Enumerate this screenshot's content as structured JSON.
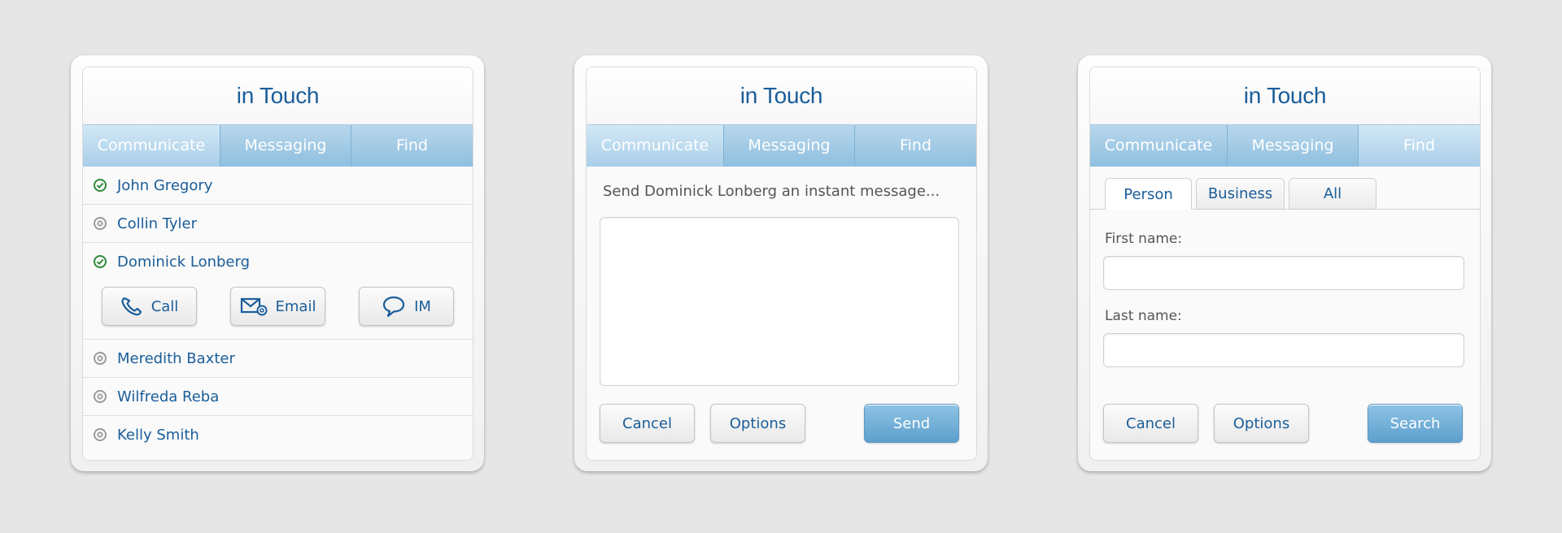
{
  "app": {
    "title": "in Touch"
  },
  "tabs": [
    "Communicate",
    "Messaging",
    "Find"
  ],
  "colors": {
    "brand": "#1a5d99",
    "tab_bar": "#8fbfdf",
    "online": "#2e8b3a",
    "offline": "#9a9a9a",
    "primary_button": "#5d9fcd"
  },
  "contacts": [
    {
      "name": "John Gregory",
      "status": "online"
    },
    {
      "name": "Collin Tyler",
      "status": "offline"
    },
    {
      "name": "Dominick Lonberg",
      "status": "online"
    },
    {
      "name": "Meredith Baxter",
      "status": "offline"
    },
    {
      "name": "Wilfreda Reba",
      "status": "offline"
    },
    {
      "name": "Kelly Smith",
      "status": "offline"
    }
  ],
  "contact_actions": {
    "call": {
      "label": "Call",
      "icon": "phone-icon"
    },
    "email": {
      "label": "Email",
      "icon": "email-icon"
    },
    "im": {
      "label": "IM",
      "icon": "chat-bubble-icon"
    }
  },
  "messaging": {
    "prompt": "Send Dominick Lonberg an instant message...",
    "message_value": "",
    "cancel": "Cancel",
    "options": "Options",
    "send": "Send"
  },
  "find": {
    "subtabs": [
      "Person",
      "Business",
      "All"
    ],
    "first_name_label": "First name:",
    "first_name_value": "",
    "last_name_label": "Last name:",
    "last_name_value": "",
    "cancel": "Cancel",
    "options": "Options",
    "search": "Search"
  }
}
